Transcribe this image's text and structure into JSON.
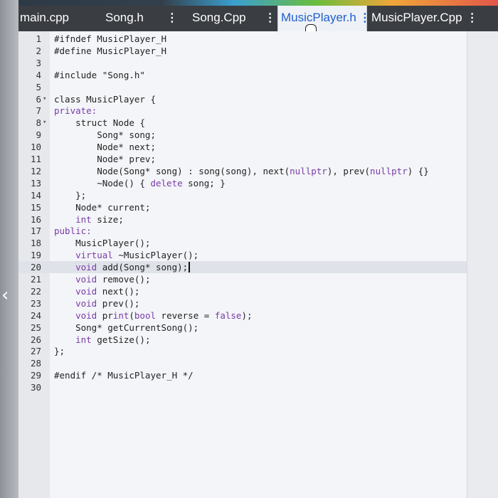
{
  "tabs": [
    {
      "label": "main.cpp",
      "active": false,
      "menu": ""
    },
    {
      "label": "Song.h",
      "active": false,
      "menu": "⋮"
    },
    {
      "label": "Song.Cpp",
      "active": false,
      "menu": "⋮"
    },
    {
      "label": "MusicPlayer.h",
      "active": true,
      "menu": "⋮"
    },
    {
      "label": "MusicPlayer.Cpp",
      "active": false,
      "menu": "⋮"
    }
  ],
  "editor": {
    "current_line": 20,
    "lines": [
      {
        "num": "1",
        "fold": "",
        "code": "#ifndef MusicPlayer_H"
      },
      {
        "num": "2",
        "fold": "",
        "code": "#define MusicPlayer_H"
      },
      {
        "num": "3",
        "fold": "",
        "code": ""
      },
      {
        "num": "4",
        "fold": "",
        "code": "#include \"Song.h\""
      },
      {
        "num": "5",
        "fold": "",
        "code": ""
      },
      {
        "num": "6",
        "fold": "▾",
        "code": "class MusicPlayer {"
      },
      {
        "num": "7",
        "fold": "",
        "code": "private:"
      },
      {
        "num": "8",
        "fold": "▾",
        "code": "    struct Node {"
      },
      {
        "num": "9",
        "fold": "",
        "code": "        Song* song;"
      },
      {
        "num": "10",
        "fold": "",
        "code": "        Node* next;"
      },
      {
        "num": "11",
        "fold": "",
        "code": "        Node* prev;"
      },
      {
        "num": "12",
        "fold": "",
        "code": "        Node(Song* song) : song(song), next(nullptr), prev(nullptr) {}"
      },
      {
        "num": "13",
        "fold": "",
        "code": "        ~Node() { delete song; }"
      },
      {
        "num": "14",
        "fold": "",
        "code": "    };"
      },
      {
        "num": "15",
        "fold": "",
        "code": "    Node* current;"
      },
      {
        "num": "16",
        "fold": "",
        "code": "    int size;"
      },
      {
        "num": "17",
        "fold": "",
        "code": "public:"
      },
      {
        "num": "18",
        "fold": "",
        "code": "    MusicPlayer();"
      },
      {
        "num": "19",
        "fold": "",
        "code": "    virtual ~MusicPlayer();"
      },
      {
        "num": "20",
        "fold": "",
        "code": "    void add(Song* song);"
      },
      {
        "num": "21",
        "fold": "",
        "code": "    void remove();"
      },
      {
        "num": "22",
        "fold": "",
        "code": "    void next();"
      },
      {
        "num": "23",
        "fold": "",
        "code": "    void prev();"
      },
      {
        "num": "24",
        "fold": "",
        "code": "    void print(bool reverse = false);"
      },
      {
        "num": "25",
        "fold": "",
        "code": "    Song* getCurrentSong();"
      },
      {
        "num": "26",
        "fold": "",
        "code": "    int getSize();"
      },
      {
        "num": "27",
        "fold": "",
        "code": "};"
      },
      {
        "num": "28",
        "fold": "",
        "code": ""
      },
      {
        "num": "29",
        "fold": "",
        "code": "#endif /* MusicPlayer_H */"
      },
      {
        "num": "30",
        "fold": "",
        "code": ""
      }
    ]
  },
  "side": {
    "back_glyph": "‹"
  },
  "colors": {
    "tab_bar": "#3a3d42",
    "active_tab_text": "#1f5fd0",
    "keyword": "#7a3ba8",
    "current_line": "#dfe3e9"
  }
}
